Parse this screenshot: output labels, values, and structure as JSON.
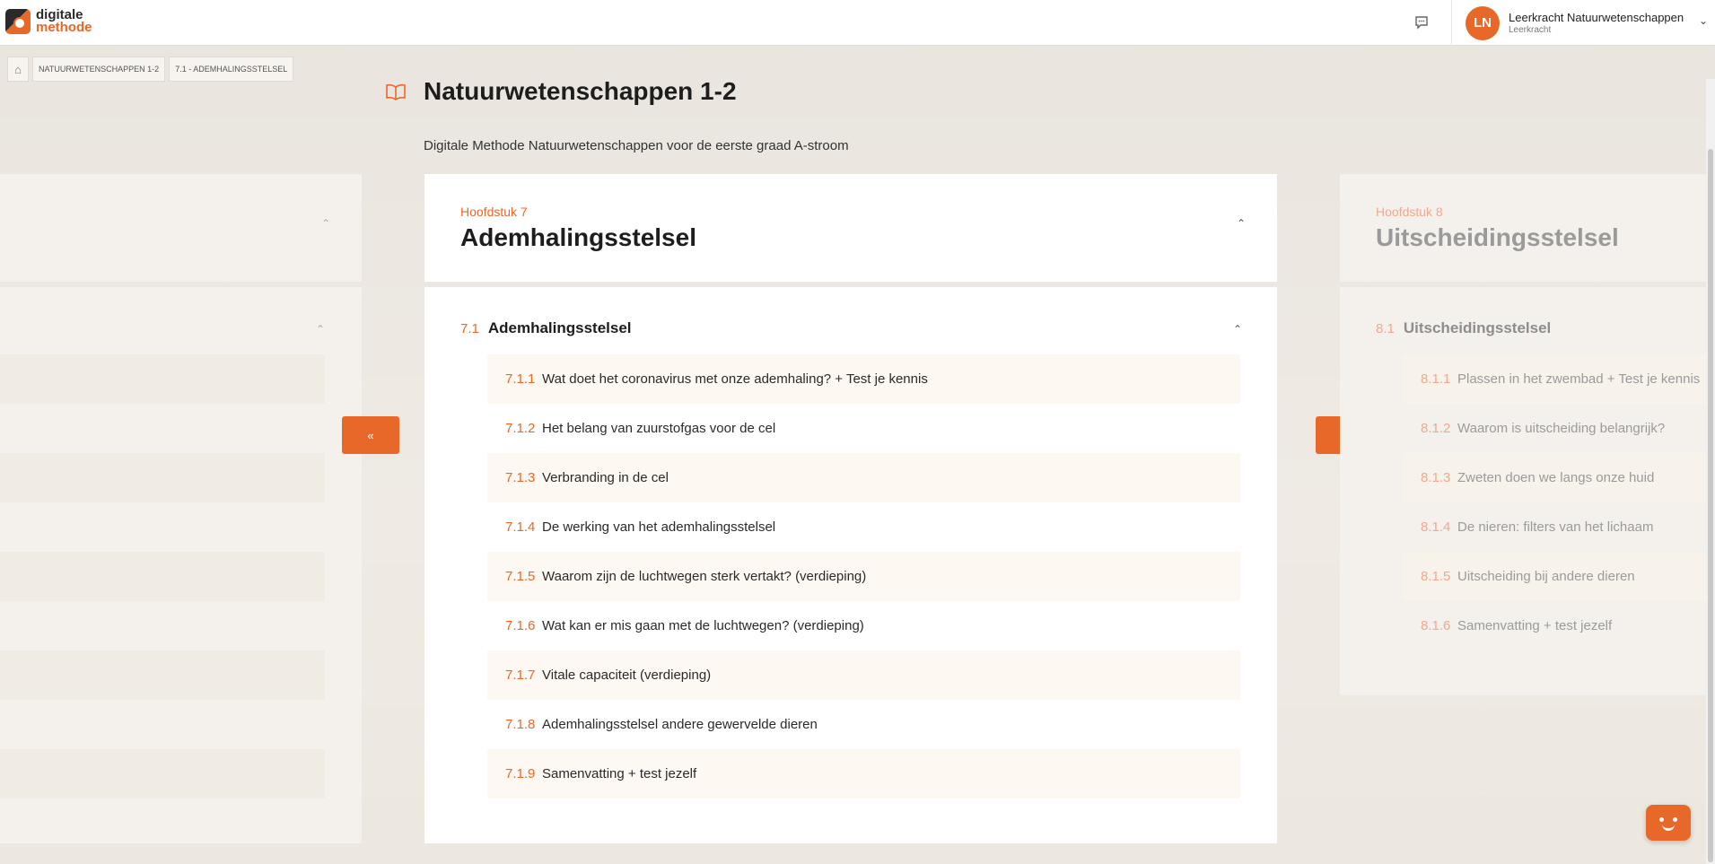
{
  "app": {
    "logo_line1": "digitale",
    "logo_line2": "methode",
    "accent_color": "#e8682a"
  },
  "user": {
    "initials": "LN",
    "name": "Leerkracht Natuurwetenschappen",
    "role": "Leerkracht"
  },
  "breadcrumb": [
    "NATUURWETENSCHAPPEN 1-2",
    "7.1 - ADEMHALINGSSTELSEL"
  ],
  "course": {
    "title": "Natuurwetenschappen 1-2",
    "subtitle": "Digitale Methode Natuurwetenschappen voor de eerste graad A-stroom"
  },
  "current_chapter": {
    "label": "Hoofdstuk 7",
    "title": "Ademhalingsstelsel",
    "section": {
      "number": "7.1",
      "title": "Ademhalingsstelsel",
      "lessons": [
        {
          "num": "7.1.1",
          "title": "Wat doet het coronavirus met onze ademhaling? + Test je kennis"
        },
        {
          "num": "7.1.2",
          "title": "Het belang van zuurstofgas voor de cel"
        },
        {
          "num": "7.1.3",
          "title": "Verbranding in de cel"
        },
        {
          "num": "7.1.4",
          "title": "De werking van het ademhalingsstelsel"
        },
        {
          "num": "7.1.5",
          "title": "Waarom zijn de luchtwegen sterk vertakt? (verdieping)"
        },
        {
          "num": "7.1.6",
          "title": "Wat kan er mis gaan met de luchtwegen? (verdieping)"
        },
        {
          "num": "7.1.7",
          "title": "Vitale capaciteit (verdieping)"
        },
        {
          "num": "7.1.8",
          "title": "Ademhalingsstelsel andere gewervelde dieren"
        },
        {
          "num": "7.1.9",
          "title": "Samenvatting + test jezelf"
        }
      ]
    }
  },
  "next_chapter": {
    "label": "Hoofdstuk 8",
    "title": "Uitscheidingsstelsel",
    "section": {
      "number": "8.1",
      "title": "Uitscheidingsstelsel",
      "lessons": [
        {
          "num": "8.1.1",
          "title": "Plassen in het zwembad + Test je kennis"
        },
        {
          "num": "8.1.2",
          "title": "Waarom is uitscheiding belangrijk?"
        },
        {
          "num": "8.1.3",
          "title": "Zweten doen we langs onze huid"
        },
        {
          "num": "8.1.4",
          "title": "De nieren: filters van het lichaam"
        },
        {
          "num": "8.1.5",
          "title": "Uitscheiding bij andere dieren"
        },
        {
          "num": "8.1.6",
          "title": "Samenvatting + test jezelf"
        }
      ]
    }
  },
  "nav": {
    "prev": "«",
    "next": "»"
  }
}
